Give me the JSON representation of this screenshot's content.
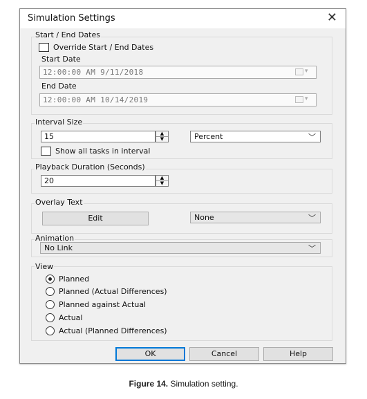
{
  "dialog": {
    "title": "Simulation Settings",
    "close_glyph": "✕"
  },
  "dates": {
    "group_label": "Start / End Dates",
    "override_label": "Override Start / End Dates",
    "start_label": "Start Date",
    "start_value": "12:00:00 AM  9/11/2018",
    "end_label": "End Date",
    "end_value": "12:00:00 AM 10/14/2019"
  },
  "interval": {
    "group_label": "Interval Size",
    "value": "15",
    "unit": "Percent",
    "show_all_label": "Show all tasks in interval"
  },
  "playback": {
    "group_label": "Playback Duration (Seconds)",
    "value": "20"
  },
  "overlay": {
    "group_label": "Overlay Text",
    "edit_label": "Edit",
    "selected": "None"
  },
  "animation": {
    "group_label": "Animation",
    "selected": "No Link"
  },
  "view": {
    "group_label": "View",
    "options": [
      "Planned",
      "Planned (Actual Differences)",
      "Planned against Actual",
      "Actual",
      "Actual (Planned Differences)"
    ],
    "selected_index": 0
  },
  "buttons": {
    "ok": "OK",
    "cancel": "Cancel",
    "help": "Help"
  },
  "caption": {
    "label": "Figure 14.",
    "text": " Simulation setting."
  }
}
